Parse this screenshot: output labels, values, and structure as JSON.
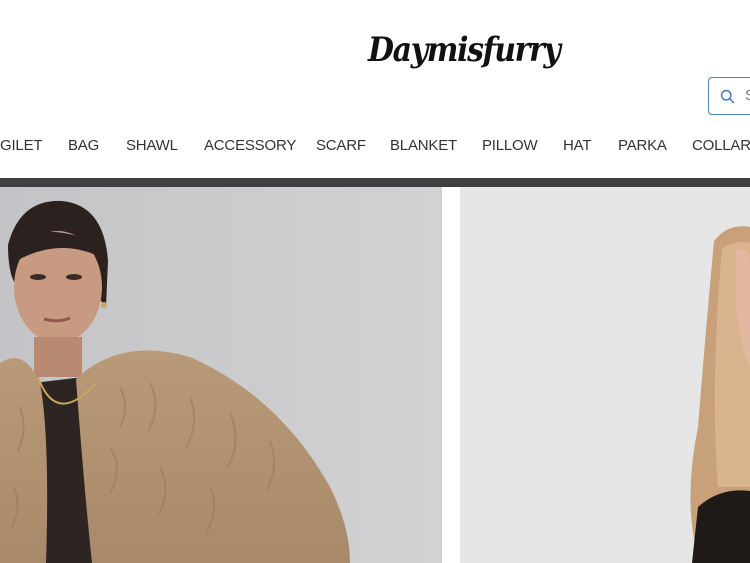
{
  "brand": {
    "logo_text": "Daymisfurry"
  },
  "search": {
    "placeholder": "S"
  },
  "nav": {
    "items": [
      "GILET",
      "BAG",
      "SHAWL",
      "ACCESSORY",
      "SCARF",
      "BLANKET",
      "PILLOW",
      "HAT",
      "PARKA",
      "COLLAR"
    ]
  },
  "colors": {
    "accent": "#4a7fc0",
    "nav_text": "#333333",
    "bar": "#3f3f3f"
  },
  "hero": {
    "left_image": "model-in-beige-fur-coat-photo",
    "right_image": "model-with-blonde-hair-photo"
  }
}
